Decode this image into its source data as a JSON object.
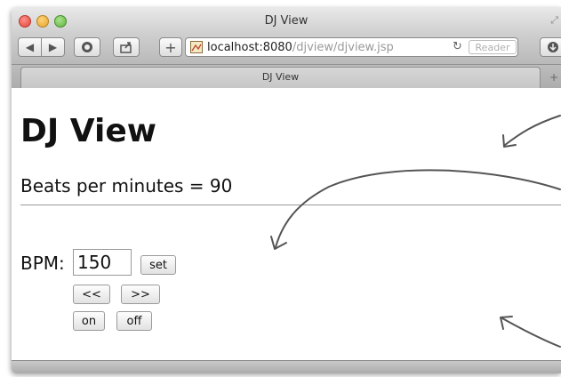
{
  "window": {
    "title": "DJ View"
  },
  "toolbar": {
    "url_host": "localhost:8080",
    "url_path": "/djview/djview.jsp",
    "reader_label": "Reader",
    "add_label": "+"
  },
  "tabs": [
    {
      "label": "DJ View"
    }
  ],
  "page": {
    "heading": "DJ View",
    "bpm_display": "Beats per minutes = 90",
    "bpm_label": "BPM:",
    "bpm_value": "150",
    "set_label": "set",
    "decrease_label": "<<",
    "increase_label": ">>",
    "on_label": "on",
    "off_label": "off"
  },
  "colors": {
    "annotation_stroke": "#555555"
  }
}
